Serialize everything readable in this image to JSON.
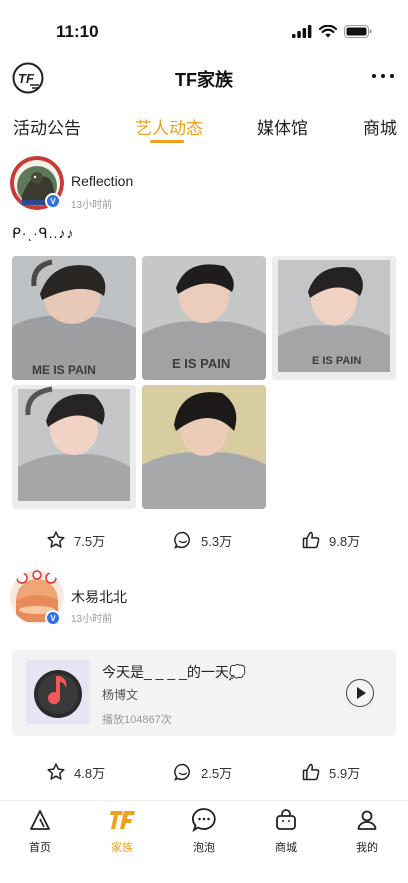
{
  "status_bar": {
    "time": "11:10"
  },
  "header": {
    "title": "TF家族",
    "logo_text": "TF"
  },
  "tabs": [
    {
      "label": "活动公告"
    },
    {
      "label": "艺人动态"
    },
    {
      "label": "媒体馆"
    },
    {
      "label": "商城"
    }
  ],
  "active_tab": "艺人动态",
  "posts": [
    {
      "username": "Reflection",
      "time": "13小时前",
      "text": "ᑭ·ͺ·ᑫ..♪♪",
      "photo_count": 5,
      "actions": {
        "favorites": "7.5万",
        "comments": "5.3万",
        "likes": "9.8万"
      }
    },
    {
      "username": "木易北北",
      "time": "13小时前",
      "music": {
        "title": "今天是_ _ _ _的一天💭",
        "artist": "杨博文",
        "plays": "播放104867次"
      },
      "actions": {
        "favorites": "4.8万",
        "comments": "2.5万",
        "likes": "5.9万"
      }
    }
  ],
  "bottom_nav": [
    {
      "label": "首页",
      "icon": "home-icon"
    },
    {
      "label": "家族",
      "icon": "family-logo-icon"
    },
    {
      "label": "泡泡",
      "icon": "chat-bubble-icon"
    },
    {
      "label": "商城",
      "icon": "shopping-bag-icon"
    },
    {
      "label": "我的",
      "icon": "profile-icon"
    }
  ],
  "colors": {
    "accent": "#f0a01a",
    "verified": "#2f6fe8",
    "text": "#222222",
    "muted": "#999999"
  }
}
